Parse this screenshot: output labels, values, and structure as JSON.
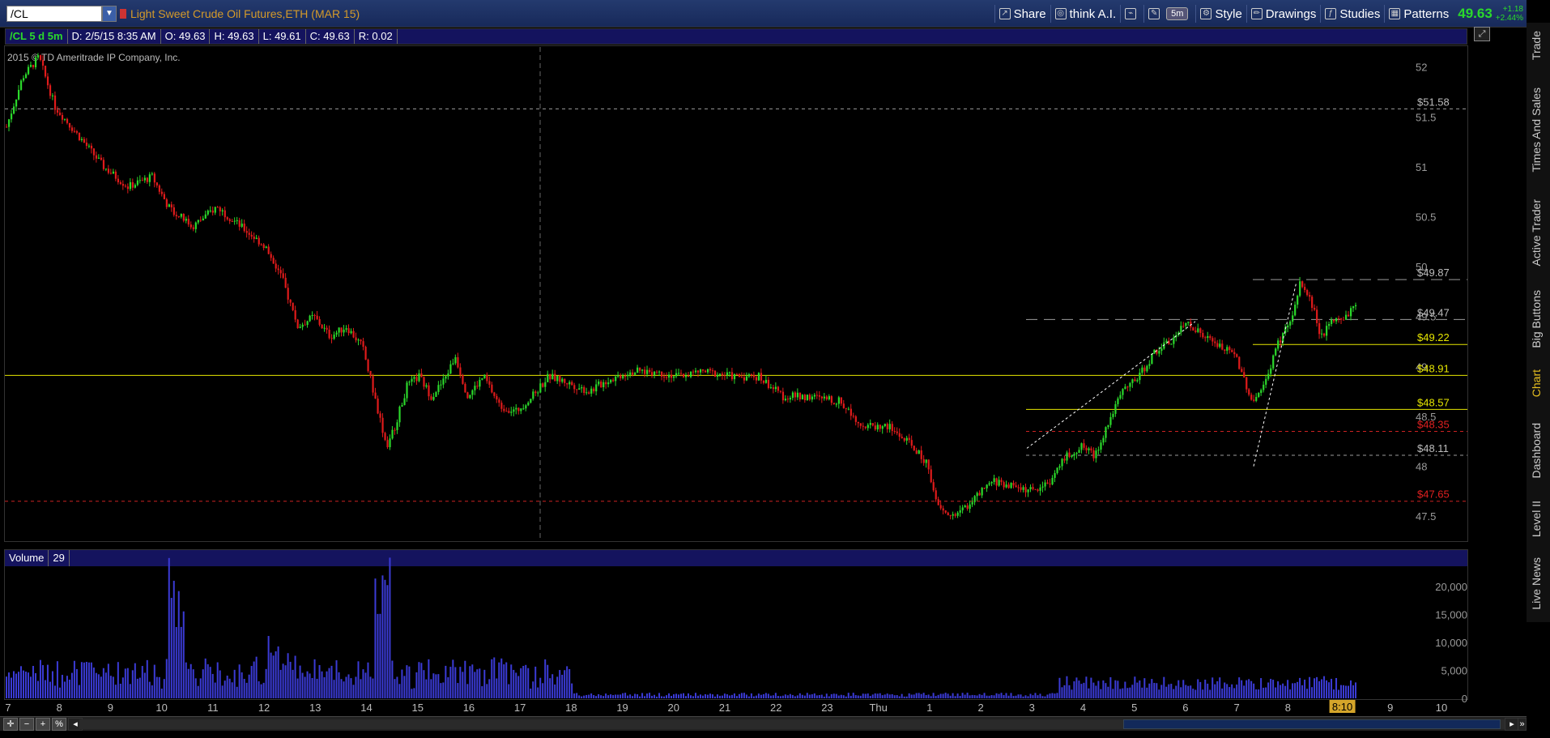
{
  "toolbar": {
    "symbol": "/CL",
    "description": "Light Sweet Crude Oil Futures,ETH (MAR 15)",
    "share": "Share",
    "think_ai": "think A.I.",
    "timeframe": "5m",
    "style": "Style",
    "drawings": "Drawings",
    "studies": "Studies",
    "patterns": "Patterns",
    "last_price": "49.63",
    "change": "+1.18",
    "change_pct": "+2.44%"
  },
  "infobar": {
    "symbol_period": "/CL 5 d 5m",
    "date": "D: 2/5/15 8:35 AM",
    "open": "O: 49.63",
    "high": "H: 49.63",
    "low": "L: 49.61",
    "close": "C: 49.63",
    "range": "R: 0.02"
  },
  "copyright": "2015 © TD Ameritrade IP Company, Inc.",
  "volume_bar": {
    "label": "Volume",
    "value": "29"
  },
  "side_tabs": [
    "Trade",
    "Times And Sales",
    "Active Trader",
    "Big Buttons",
    "Chart",
    "Dashboard",
    "Level II",
    "Live News"
  ],
  "colors": {
    "up": "#2bd92b",
    "down": "#e01b1b",
    "volume": "#3b3bd6",
    "yellow_line": "#e6e600",
    "red_line": "#c22",
    "grey_line": "#9a9a9a",
    "background": "#000000"
  },
  "chart_data": {
    "type": "candlestick",
    "price_axis": {
      "ticks": [
        "52",
        "51.5",
        "51",
        "50.5",
        "50",
        "49.5",
        "49",
        "48.5",
        "48",
        "47.5"
      ],
      "range": [
        47.25,
        52.2
      ]
    },
    "price_levels": [
      {
        "label": "$51.58",
        "price": 51.58,
        "style": "grey-dashed"
      },
      {
        "label": "$49.87",
        "price": 49.87,
        "style": "grey-long-dash"
      },
      {
        "label": "$49.47",
        "price": 49.47,
        "style": "grey-long-dash"
      },
      {
        "label": "$49.22",
        "price": 49.22,
        "style": "yellow"
      },
      {
        "label": "$48.91",
        "price": 48.91,
        "style": "yellow-full"
      },
      {
        "label": "$48.57",
        "price": 48.57,
        "style": "yellow"
      },
      {
        "label": "$48.35",
        "price": 48.35,
        "style": "red-dashed"
      },
      {
        "label": "$48.11",
        "price": 48.11,
        "style": "grey-dashed"
      },
      {
        "label": "$47.65",
        "price": 47.65,
        "style": "red-dashed-full"
      }
    ],
    "time_axis": [
      "7",
      "8",
      "9",
      "10",
      "11",
      "12",
      "13",
      "14",
      "15",
      "16",
      "17",
      "18",
      "19",
      "20",
      "21",
      "22",
      "23",
      "Thu",
      "1",
      "2",
      "3",
      "4",
      "5",
      "6",
      "7",
      "8",
      "8:10",
      "9",
      "10"
    ],
    "volume_axis": [
      "20,000",
      "15,000",
      "10,000",
      "5,000",
      "0"
    ],
    "price_path": [
      [
        0,
        51.4
      ],
      [
        20,
        51.9
      ],
      [
        40,
        52.1
      ],
      [
        60,
        51.6
      ],
      [
        90,
        51.3
      ],
      [
        120,
        51.0
      ],
      [
        150,
        50.8
      ],
      [
        180,
        50.9
      ],
      [
        200,
        50.6
      ],
      [
        230,
        50.4
      ],
      [
        260,
        50.6
      ],
      [
        290,
        50.4
      ],
      [
        320,
        50.2
      ],
      [
        340,
        49.9
      ],
      [
        360,
        49.4
      ],
      [
        380,
        49.5
      ],
      [
        400,
        49.3
      ],
      [
        420,
        49.4
      ],
      [
        440,
        49.2
      ],
      [
        455,
        48.7
      ],
      [
        470,
        48.2
      ],
      [
        480,
        48.4
      ],
      [
        495,
        48.8
      ],
      [
        510,
        48.9
      ],
      [
        525,
        48.7
      ],
      [
        540,
        48.85
      ],
      [
        555,
        49.1
      ],
      [
        570,
        48.7
      ],
      [
        590,
        48.9
      ],
      [
        610,
        48.6
      ],
      [
        630,
        48.55
      ],
      [
        650,
        48.7
      ],
      [
        670,
        48.9
      ],
      [
        690,
        48.85
      ],
      [
        720,
        48.75
      ],
      [
        740,
        48.85
      ],
      [
        770,
        48.95
      ],
      [
        800,
        48.95
      ],
      [
        830,
        48.9
      ],
      [
        860,
        48.95
      ],
      [
        900,
        48.9
      ],
      [
        930,
        48.9
      ],
      [
        960,
        48.7
      ],
      [
        990,
        48.7
      ],
      [
        1030,
        48.65
      ],
      [
        1060,
        48.4
      ],
      [
        1090,
        48.4
      ],
      [
        1120,
        48.2
      ],
      [
        1140,
        48.0
      ],
      [
        1150,
        47.6
      ],
      [
        1165,
        47.5
      ],
      [
        1180,
        47.55
      ],
      [
        1200,
        47.7
      ],
      [
        1220,
        47.85
      ],
      [
        1245,
        47.8
      ],
      [
        1270,
        47.75
      ],
      [
        1290,
        47.85
      ],
      [
        1310,
        48.1
      ],
      [
        1330,
        48.2
      ],
      [
        1345,
        48.1
      ],
      [
        1360,
        48.4
      ],
      [
        1380,
        48.75
      ],
      [
        1400,
        48.9
      ],
      [
        1420,
        49.15
      ],
      [
        1440,
        49.25
      ],
      [
        1460,
        49.45
      ],
      [
        1480,
        49.3
      ],
      [
        1500,
        49.2
      ],
      [
        1520,
        49.1
      ],
      [
        1540,
        48.65
      ],
      [
        1555,
        48.8
      ],
      [
        1570,
        49.2
      ],
      [
        1590,
        49.5
      ],
      [
        1600,
        49.85
      ],
      [
        1615,
        49.6
      ],
      [
        1625,
        49.3
      ],
      [
        1640,
        49.45
      ],
      [
        1655,
        49.5
      ],
      [
        1670,
        49.63
      ]
    ]
  }
}
